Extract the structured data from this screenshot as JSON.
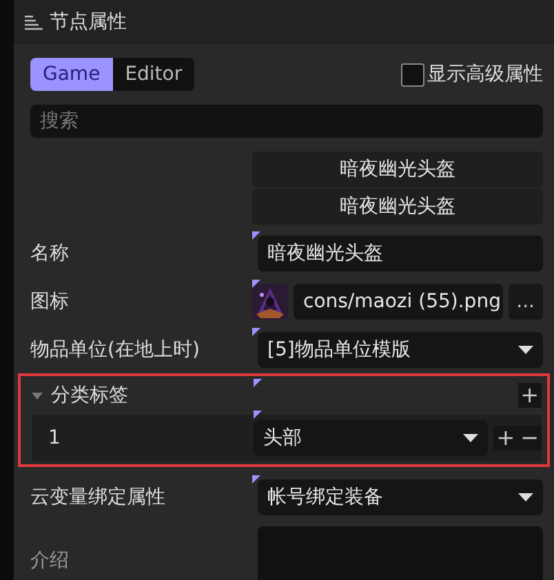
{
  "panel": {
    "title": "节点属性"
  },
  "tabs": [
    {
      "label": "Game",
      "selected": true
    },
    {
      "label": "Editor",
      "selected": false
    }
  ],
  "advanced": {
    "label": "显示高级属性",
    "checked": false
  },
  "search": {
    "placeholder": "搜索"
  },
  "header_rows": [
    "暗夜幽光头盔",
    "暗夜幽光头盔"
  ],
  "properties": [
    {
      "kind": "text",
      "label": "名称",
      "value": "暗夜幽光头盔",
      "marked": true
    },
    {
      "kind": "file",
      "label": "图标",
      "value": "cons/maozi (55).png",
      "button": "...",
      "marked": true
    },
    {
      "kind": "select",
      "label": "物品单位(在地上时)",
      "value": "[5]物品单位模版",
      "marked": true
    },
    {
      "kind": "list",
      "label": "分类标签",
      "expanded": true,
      "highlighted": true,
      "marked": true,
      "add": "+",
      "items": [
        {
          "index": "1",
          "value": "头部",
          "marked": true,
          "add": "+",
          "remove": "−"
        }
      ]
    },
    {
      "kind": "select",
      "label": "云变量绑定属性",
      "value": "帐号绑定装备",
      "marked": true
    },
    {
      "kind": "textarea",
      "label": "介绍"
    }
  ]
}
